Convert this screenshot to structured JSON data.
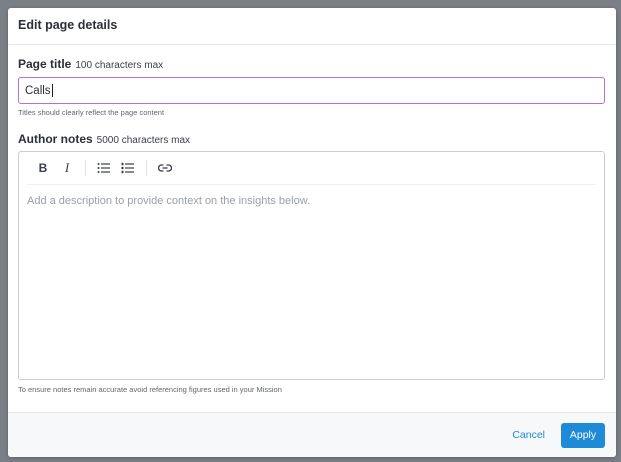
{
  "modal": {
    "title": "Edit page details"
  },
  "page_title": {
    "label": "Page title",
    "limit": "100 characters max",
    "value": "Calls",
    "helper": "Titles should clearly reflect the page content"
  },
  "author_notes": {
    "label": "Author notes",
    "limit": "5000 characters max",
    "placeholder": "Add a description to provide context on the insights below.",
    "helper": "To ensure notes remain accurate avoid referencing figures used in your Mission",
    "toolbar": {
      "bold_label": "B",
      "italic_label": "I",
      "icons": [
        "bullet-list-icon",
        "numbered-list-icon",
        "link-icon"
      ]
    }
  },
  "footer": {
    "cancel_label": "Cancel",
    "apply_label": "Apply"
  },
  "colors": {
    "accent": "#1f8ad8",
    "focus_border": "#b76fd1",
    "overlay": "#7b7f86"
  }
}
